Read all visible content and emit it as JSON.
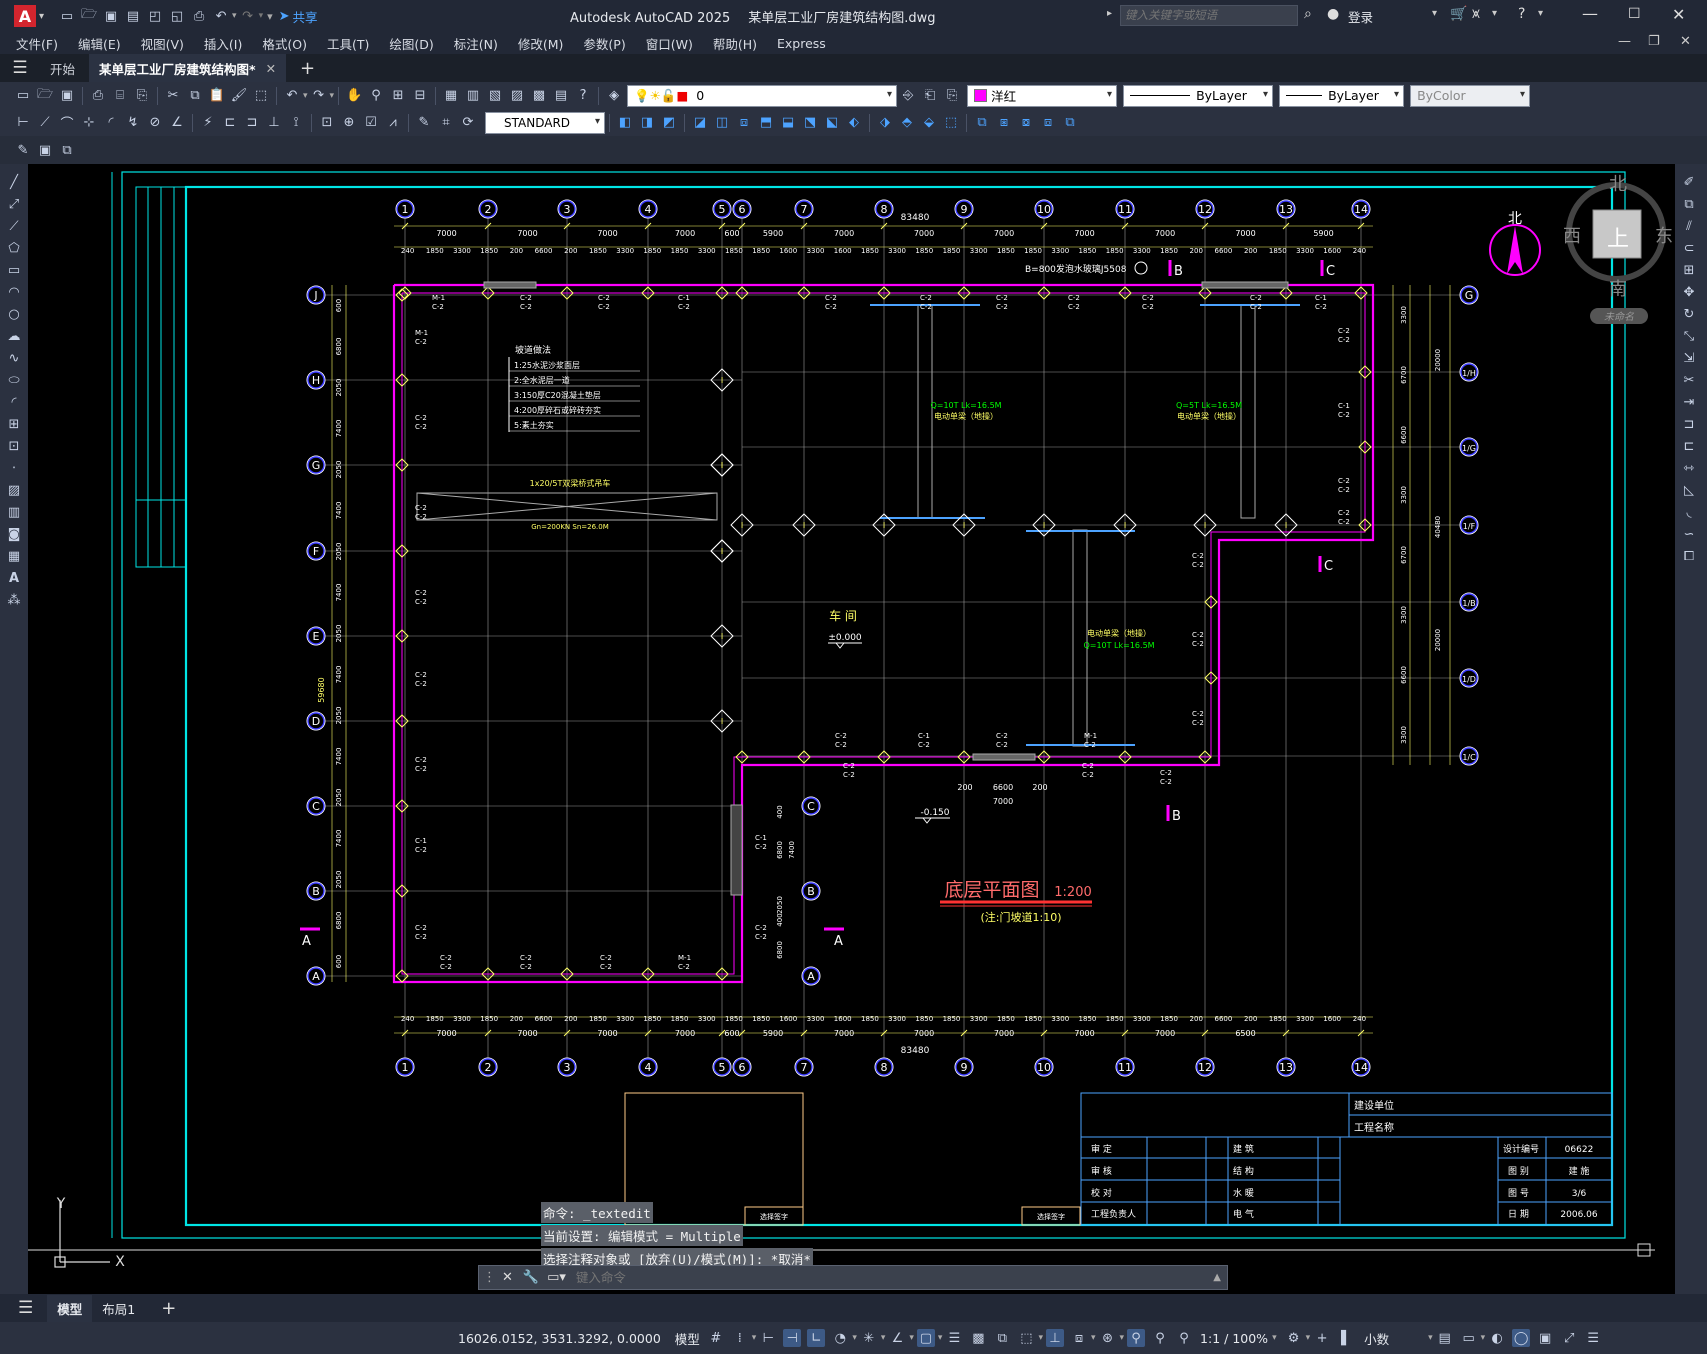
{
  "app": {
    "window_title": "Autodesk AutoCAD 2025",
    "file_title": "某单层工业厂房建筑结构图.dwg",
    "share_label": "共享",
    "search_placeholder": "键入关键字或短语",
    "login_label": "登录"
  },
  "menu": [
    "文件(F)",
    "编辑(E)",
    "视图(V)",
    "插入(I)",
    "格式(O)",
    "工具(T)",
    "绘图(D)",
    "标注(N)",
    "修改(M)",
    "参数(P)",
    "窗口(W)",
    "帮助(H)",
    "Express"
  ],
  "tabs": {
    "start": "开始",
    "doc": "某单层工业厂房建筑结构图*"
  },
  "toolbar": {
    "layer_value": "0",
    "color_value": "洋红",
    "linetype_value": "ByLayer",
    "lineweight_value": "ByLayer",
    "plotstyle_value": "ByColor",
    "textstyle_value": "STANDARD"
  },
  "colors": {
    "canvas_bg": "#000000",
    "frame": "#00e5e5",
    "wall": "#ff00ff",
    "grid_line": "#c8c8c8",
    "dimension": "#ffff66",
    "axis_bubble": "#3a3aff",
    "label_text": "#ffffff",
    "green_text": "#00ff00"
  },
  "viewcube": {
    "north": "北",
    "south": "南",
    "east": "东",
    "west": "西",
    "top": "上",
    "ucs": "未命名",
    "compass_north": "北"
  },
  "drawing": {
    "title": "底层平面图",
    "scale": "1:200",
    "note": "(注:门坡道1:10)",
    "col_axes": [
      "1",
      "2",
      "3",
      "4",
      "5",
      "6",
      "7",
      "8",
      "9",
      "10",
      "11",
      "12",
      "13",
      "14"
    ],
    "row_axes_left": [
      "J",
      "H",
      "G",
      "F",
      "E",
      "D",
      "C",
      "B",
      "A"
    ],
    "row_axes_right": [
      "G",
      "1/H",
      "1/G",
      "1/F",
      "1/B",
      "1/D",
      "1/C"
    ],
    "total_width": "83480",
    "top_dims": [
      "7000",
      "7000",
      "7000",
      "7000",
      "600",
      "5900",
      "7000",
      "7000",
      "7000",
      "7000",
      "7000",
      "7000",
      "5900",
      "600"
    ],
    "bottom_dims": [
      "7000",
      "7000",
      "7000",
      "7000",
      "600",
      "5900",
      "7000",
      "7000",
      "7000",
      "7000",
      "7000",
      "6500"
    ],
    "sub_dims": [
      "240",
      "1850",
      "3300",
      "1850",
      "200",
      "6600",
      "200",
      "1850",
      "3300",
      "1850",
      "1850",
      "3300",
      "1850",
      "1850",
      "1600",
      "3300",
      "1600",
      "1850",
      "3300",
      "1850",
      "1850",
      "3300",
      "1850",
      "1850",
      "3300",
      "1850",
      "1850",
      "3300",
      "1850",
      "200",
      "6600",
      "200",
      "1850",
      "3300",
      "1600",
      "240"
    ],
    "left_dims": [
      "600",
      "6800",
      "2050",
      "7400",
      "2050",
      "7400",
      "2050",
      "7400",
      "2050",
      "7400",
      "2050",
      "7400",
      "2050",
      "7400",
      "2050",
      "6800",
      "600"
    ],
    "left_total": "59680",
    "right_dims": [
      "3300",
      "6700",
      "6600",
      "3300",
      "6700",
      "3300",
      "6600",
      "3300"
    ],
    "right_totals": [
      "20000",
      "40480",
      "20000"
    ],
    "workshop_label": "车 间",
    "elevation_in": "±0.000",
    "elevation_out": "-0.150",
    "crane_top": "Q=10T Lk=16.5M",
    "crane_right": "Q=5T Lk=16.5M",
    "crane_label": "电动单梁（地操）",
    "crane_left": "1x20/5T双梁桥式吊车",
    "crane_left_params": "Gn=200KN  Sn=26.0M",
    "door_label": "B=800发泡水玻璃J5508",
    "section_a": "A",
    "section_b": "B",
    "section_c": "C",
    "window_tags": [
      "C-2",
      "C-1",
      "M-1"
    ],
    "legend_title": "坡道做法",
    "legend_lines": [
      "1:25水泥沙浆面层",
      "2:全水泥层一道",
      "3:150厚C20混凝土垫层",
      "4:200厚碎石或碎砖夯实",
      "5:素土夯实"
    ],
    "dim_small": [
      "200",
      "6600",
      "200",
      "7000"
    ],
    "mid_left_dims": [
      "400",
      "6800",
      "7400",
      "2050",
      "400",
      "6800"
    ]
  },
  "titleblock": {
    "build_unit": "建设单位",
    "project": "工程名称",
    "roles": [
      "审 定",
      "审 核",
      "校 对",
      "工程负责人"
    ],
    "disciplines": [
      "建 筑",
      "结 构",
      "水 暖",
      "电 气"
    ],
    "fields": [
      {
        "k": "设计编号",
        "v": "06622"
      },
      {
        "k": "图 别",
        "v": "建 施"
      },
      {
        "k": "图 号",
        "v": "3/6"
      },
      {
        "k": "日 期",
        "v": "2006.06"
      }
    ],
    "small_boxes": [
      "选择签字",
      "选择签字"
    ]
  },
  "command": {
    "lines": [
      "命令: _textedit",
      "当前设置: 编辑模式 = Multiple",
      "选择注释对象或 [放弃(U)/模式(M)]: *取消*"
    ],
    "placeholder": "键入命令"
  },
  "layouts": {
    "model": "模型",
    "layout1": "布局1"
  },
  "status": {
    "coords": "16026.0152, 3531.3292, 0.0000",
    "model": "模型",
    "scale": "1:1 / 100%",
    "units": "小数"
  },
  "ucs": {
    "x": "X",
    "y": "Y"
  }
}
